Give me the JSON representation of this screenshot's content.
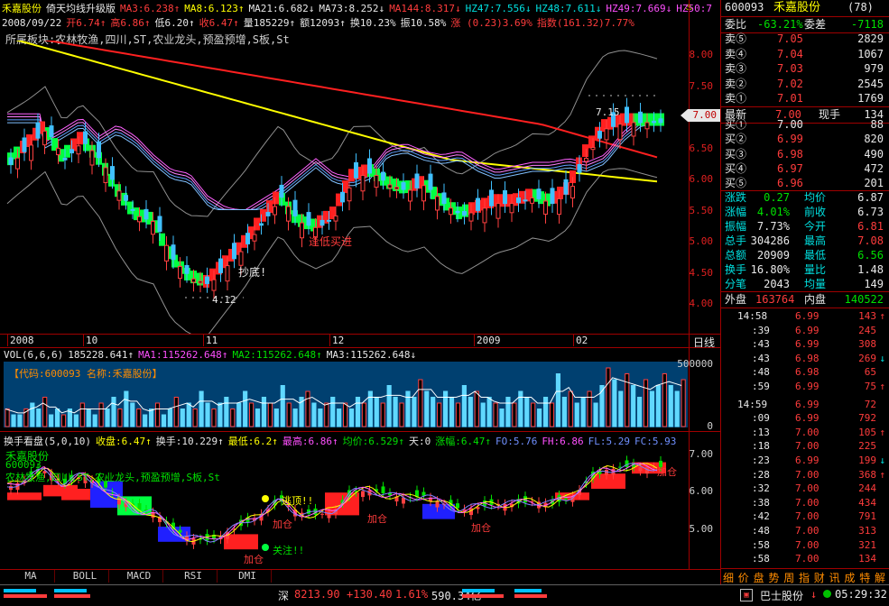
{
  "chart_header": {
    "stock": "禾嘉股份",
    "indicator": "倚天均线升级版",
    "ma3": "MA3:6.238↑",
    "ma8": "MA8:6.123↑",
    "ma21": "MA21:6.682↓",
    "ma73": "MA73:8.252↓",
    "ma144": "MA144:8.317↓",
    "hz47": "HZ47:7.556↓",
    "hz48": "HZ48:7.611↓",
    "hz49": "HZ49:7.669↓",
    "hz50": "HZ50:7"
  },
  "quote_line": {
    "date": "2008/09/22",
    "open": "开6.74↑",
    "high": "高6.86↑",
    "low": "低6.20↑",
    "close": "收6.47↑",
    "volume": "量185229↑",
    "amount": "额12093↑",
    "turnover": "换10.23%",
    "amplitude": "振10.58%",
    "change": "涨 (0.23)3.69%",
    "index": "指数(161.32)7.77%"
  },
  "sector_line": "所属板块:农林牧渔,四川,ST,农业龙头,预盈预增,S板,St",
  "price_axis": [
    "8.00",
    "7.50",
    "7.00",
    "6.50",
    "6.00",
    "5.50",
    "5.00",
    "4.50",
    "4.00"
  ],
  "current_price_tag": "7.00",
  "annotations": {
    "high_mark": "7.15",
    "low_mark": "4.12",
    "buy_signal": "逢低买进",
    "bottom_signal": "抄底!"
  },
  "date_axis": [
    "2008",
    "10",
    "11",
    "12",
    "2009",
    "02"
  ],
  "period": "日线",
  "vol_header": {
    "label": "VOL(6,6,6)",
    "vol": "185228.641↑",
    "ma1": "MA1:115262.648↑",
    "ma2": "MA2:115262.648↑",
    "ma3": "MA3:115262.648↓"
  },
  "vol_info": "【代码:600093 名称:禾嘉股份】",
  "vol_axis": [
    "500000",
    "0"
  ],
  "vol_data": [
    3,
    2,
    2,
    3,
    4,
    3,
    5,
    2,
    3,
    2,
    3,
    2,
    4,
    3,
    2,
    4,
    3,
    5,
    3,
    6,
    4,
    3,
    2,
    3,
    4,
    2,
    3,
    5,
    3,
    4,
    3,
    6,
    4,
    3,
    4,
    5,
    3,
    4,
    6,
    4,
    3,
    5,
    4,
    3,
    7,
    4,
    3,
    5,
    6,
    4,
    3,
    4,
    5,
    3,
    4,
    3,
    5,
    4,
    6,
    5,
    4,
    7,
    5,
    4,
    6,
    5,
    8,
    6,
    5,
    4,
    6,
    5,
    4,
    7,
    5,
    6,
    4,
    5,
    4,
    3,
    5,
    4,
    6,
    5,
    4,
    3,
    5,
    4,
    9,
    5,
    6,
    4,
    5,
    6,
    4,
    7,
    10,
    8,
    6,
    9,
    7,
    5,
    8,
    6,
    7,
    9,
    7,
    6,
    8
  ],
  "ind_header": {
    "label": "换手看盘(5,0,10)",
    "close": "收盘:6.47↑",
    "turnover": "换手:10.229↑",
    "low": "最低:6.2↑",
    "high": "最高:6.86↑",
    "avg": "均价:6.529↑",
    "flag": "天:0",
    "limit": "涨幅:6.47↑",
    "fo": "FO:5.76",
    "fh": "FH:6.86",
    "fl": "FL:5.29",
    "fc": "FC:5.93"
  },
  "ind_info": [
    "禾嘉股份",
    "600093",
    "农林牧渔,四川,ST,农业龙头,预盈预增,S板,St"
  ],
  "ind_axis": [
    "7.00",
    "6.00",
    "5.00"
  ],
  "ind_signals": [
    "逃顶!!",
    "关注!!",
    "加仓",
    "加仓",
    "加仓",
    "加仓",
    "加仓"
  ],
  "tabs": [
    "MA",
    "BOLL",
    "MACD",
    "RSI",
    "DMI"
  ],
  "quote": {
    "code": "600093",
    "name": "禾嘉股份",
    "rank": "(78)",
    "webi_label": "委比",
    "webi": "-63.21%",
    "weicha_label": "委差",
    "weicha": "-7118",
    "asks": [
      {
        "label": "卖⑤",
        "price": "7.05",
        "vol": "2829"
      },
      {
        "label": "卖④",
        "price": "7.04",
        "vol": "1067"
      },
      {
        "label": "卖③",
        "price": "7.03",
        "vol": "979"
      },
      {
        "label": "卖②",
        "price": "7.02",
        "vol": "2545"
      },
      {
        "label": "卖①",
        "price": "7.01",
        "vol": "1769"
      }
    ],
    "last_label": "最新",
    "last": "7.00",
    "cur_label": "现手",
    "cur": "134",
    "bids": [
      {
        "label": "买①",
        "price": "7.00",
        "vol": "88"
      },
      {
        "label": "买②",
        "price": "6.99",
        "vol": "820"
      },
      {
        "label": "买③",
        "price": "6.98",
        "vol": "490"
      },
      {
        "label": "买④",
        "price": "6.97",
        "vol": "472"
      },
      {
        "label": "买⑤",
        "price": "6.96",
        "vol": "201"
      }
    ],
    "stats": [
      {
        "l1": "涨跌",
        "v1": "0.27",
        "l2": "均价",
        "v2": "6.87"
      },
      {
        "l1": "涨幅",
        "v1": "4.01%",
        "l2": "前收",
        "v2": "6.73"
      },
      {
        "l1": "振幅",
        "v1": "7.73%",
        "l2": "今开",
        "v2": "6.81"
      },
      {
        "l1": "总手",
        "v1": "304286",
        "l2": "最高",
        "v2": "7.08"
      },
      {
        "l1": "总额",
        "v1": "20909",
        "l2": "最低",
        "v2": "6.56"
      },
      {
        "l1": "换手",
        "v1": "16.80%",
        "l2": "量比",
        "v2": "1.48"
      },
      {
        "l1": "分笔",
        "v1": "2043",
        "l2": "均量",
        "v2": "149"
      }
    ],
    "outer_label": "外盘",
    "outer": "163764",
    "inner_label": "内盘",
    "inner": "140522"
  },
  "ticks": [
    {
      "t": "14:58",
      "p": "6.99",
      "v": "143",
      "a": "↑"
    },
    {
      "t": ":39",
      "p": "6.99",
      "v": "245",
      "a": ""
    },
    {
      "t": ":43",
      "p": "6.99",
      "v": "308",
      "a": ""
    },
    {
      "t": ":43",
      "p": "6.98",
      "v": "269",
      "a": "↓"
    },
    {
      "t": ":48",
      "p": "6.98",
      "v": "65",
      "a": ""
    },
    {
      "t": ":59",
      "p": "6.99",
      "v": "75",
      "a": "↑"
    },
    {
      "t": "14:59",
      "p": "6.99",
      "v": "72",
      "a": ""
    },
    {
      "t": ":09",
      "p": "6.99",
      "v": "792",
      "a": ""
    },
    {
      "t": ":13",
      "p": "7.00",
      "v": "105",
      "a": "↑"
    },
    {
      "t": ":18",
      "p": "7.00",
      "v": "225",
      "a": ""
    },
    {
      "t": ":23",
      "p": "6.99",
      "v": "199",
      "a": "↓"
    },
    {
      "t": ":28",
      "p": "7.00",
      "v": "368",
      "a": "↑"
    },
    {
      "t": ":32",
      "p": "7.00",
      "v": "244",
      "a": ""
    },
    {
      "t": ":38",
      "p": "7.00",
      "v": "434",
      "a": ""
    },
    {
      "t": ":42",
      "p": "7.00",
      "v": "791",
      "a": ""
    },
    {
      "t": ":48",
      "p": "7.00",
      "v": "313",
      "a": ""
    },
    {
      "t": ":58",
      "p": "7.00",
      "v": "321",
      "a": ""
    },
    {
      "t": ":58",
      "p": "7.00",
      "v": "134",
      "a": ""
    }
  ],
  "side_menu": [
    "细",
    "价",
    "盘",
    "势",
    "周",
    "指",
    "财",
    "讯",
    "成",
    "特",
    "解"
  ],
  "status": {
    "index_name": "深",
    "index_value": "8213.90",
    "index_change": "+130.40",
    "index_pct": "1.61%",
    "index_amount": "590.34亿",
    "scroll_stock": "巴士股份",
    "time": "05:29:32"
  },
  "colors": {
    "up": "#ff3c3c",
    "down": "#00e000",
    "grid": "#a00000",
    "volume_bg": "#004070"
  }
}
